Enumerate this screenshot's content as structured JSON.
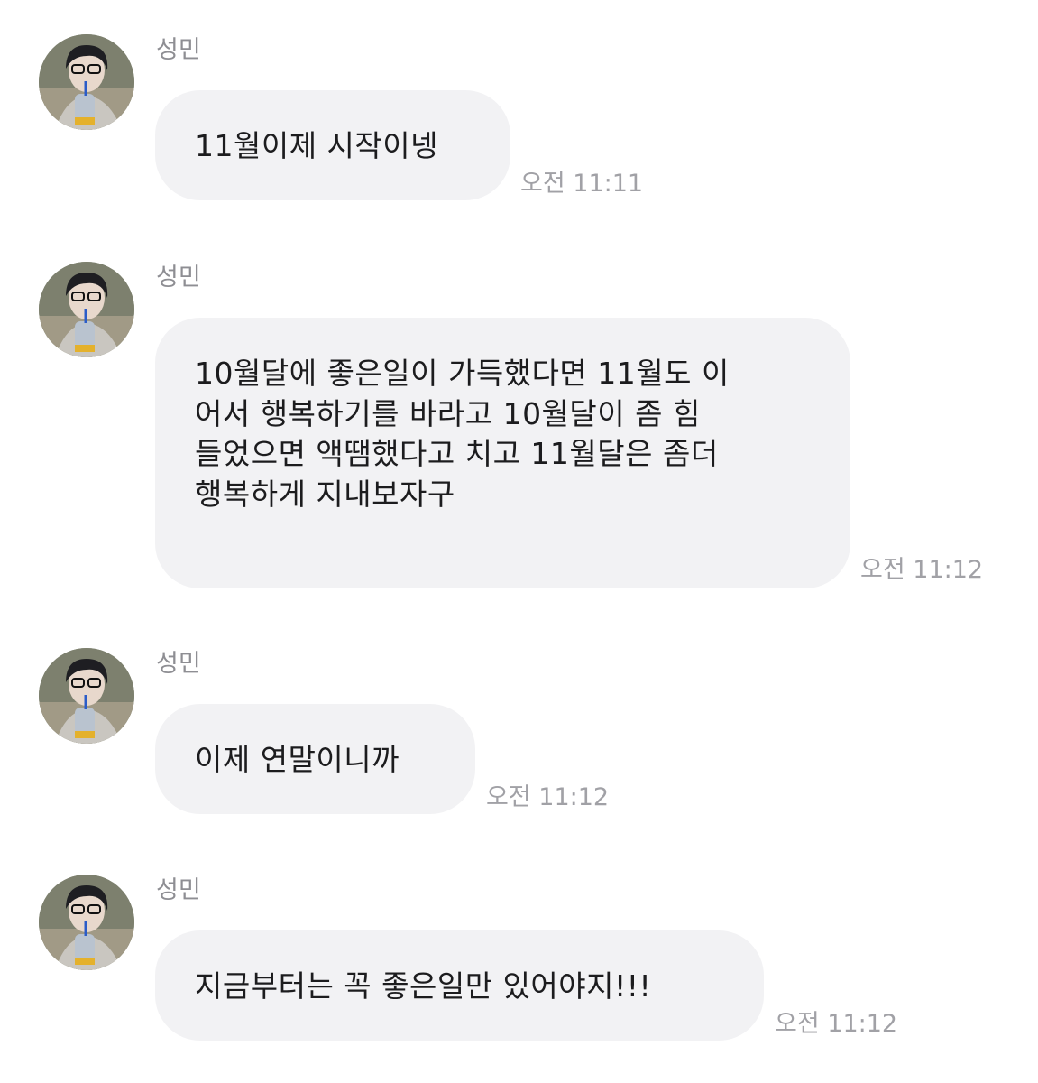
{
  "messages": [
    {
      "sender": "성민",
      "text": "11월이제 시작이넹",
      "time": "오전 11:11",
      "avatar_icon": "profile-photo-icon"
    },
    {
      "sender": "성민",
      "text": "10월달에 좋은일이 가득했다면 11월도 이\n어서 행복하기를 바라고 10월달이 좀 힘\n들었으면 액땜했다고 치고 11월달은 좀더\n행복하게 지내보자구",
      "time": "오전 11:12",
      "avatar_icon": "profile-photo-icon"
    },
    {
      "sender": "성민",
      "text": "이제 연말이니까",
      "time": "오전 11:12",
      "avatar_icon": "profile-photo-icon"
    },
    {
      "sender": "성민",
      "text": "지금부터는 꼭 좋은일만 있어야지!!!",
      "time": "오전 11:12",
      "avatar_icon": "profile-photo-icon"
    }
  ],
  "colors": {
    "bubble": "#f2f2f4",
    "text": "#1c1c1e",
    "meta": "#8e8e93"
  }
}
